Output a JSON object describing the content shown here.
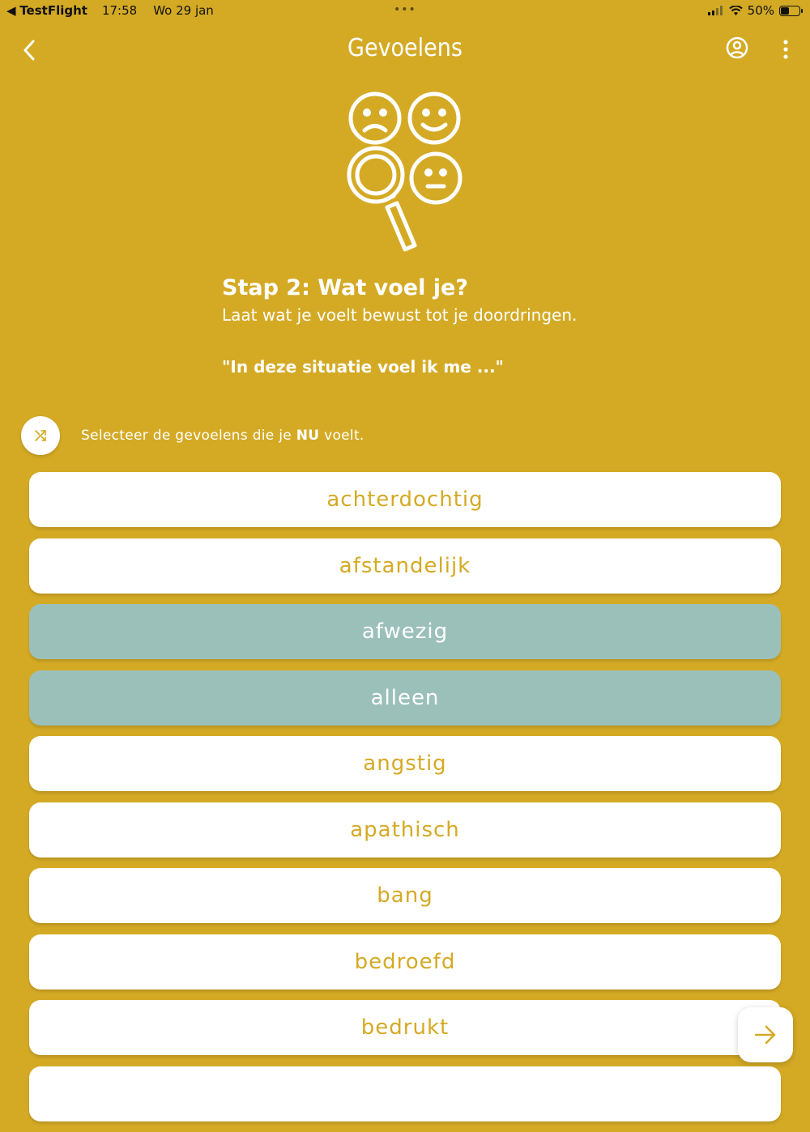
{
  "status_bar": {
    "back_app": "TestFlight",
    "time": "17:58",
    "date": "Wo 29 jan",
    "battery": "50%",
    "battery_level": 0.5
  },
  "header": {
    "title": "Gevoelens",
    "back_icon": "chevron-left-icon",
    "profile_icon": "user-circle-icon",
    "more_icon": "more-vertical-icon"
  },
  "illustration": "faces-magnifier-icon",
  "step": {
    "title": "Stap 2: Wat voel je?",
    "subtitle": "Laat wat je voelt bewust tot je doordringen.",
    "quote": "\"In deze situatie voel ik me ...\""
  },
  "instruction": {
    "before": "Selecteer de gevoelens die je ",
    "emphasis": "NU",
    "after": " voelt."
  },
  "feelings": [
    {
      "label": "achterdochtig",
      "selected": false
    },
    {
      "label": "afstandelijk",
      "selected": false
    },
    {
      "label": "afwezig",
      "selected": true
    },
    {
      "label": "alleen",
      "selected": true
    },
    {
      "label": "angstig",
      "selected": false
    },
    {
      "label": "apathisch",
      "selected": false
    },
    {
      "label": "bang",
      "selected": false
    },
    {
      "label": "bedroefd",
      "selected": false
    },
    {
      "label": "bedrukt",
      "selected": false
    },
    {
      "label": "",
      "selected": false
    }
  ],
  "colors": {
    "background": "#D4AA25",
    "selected": "#9BC0BA",
    "card": "#FFFFFF"
  },
  "next_icon": "arrow-right-icon",
  "shuffle_icon": "shuffle-icon"
}
